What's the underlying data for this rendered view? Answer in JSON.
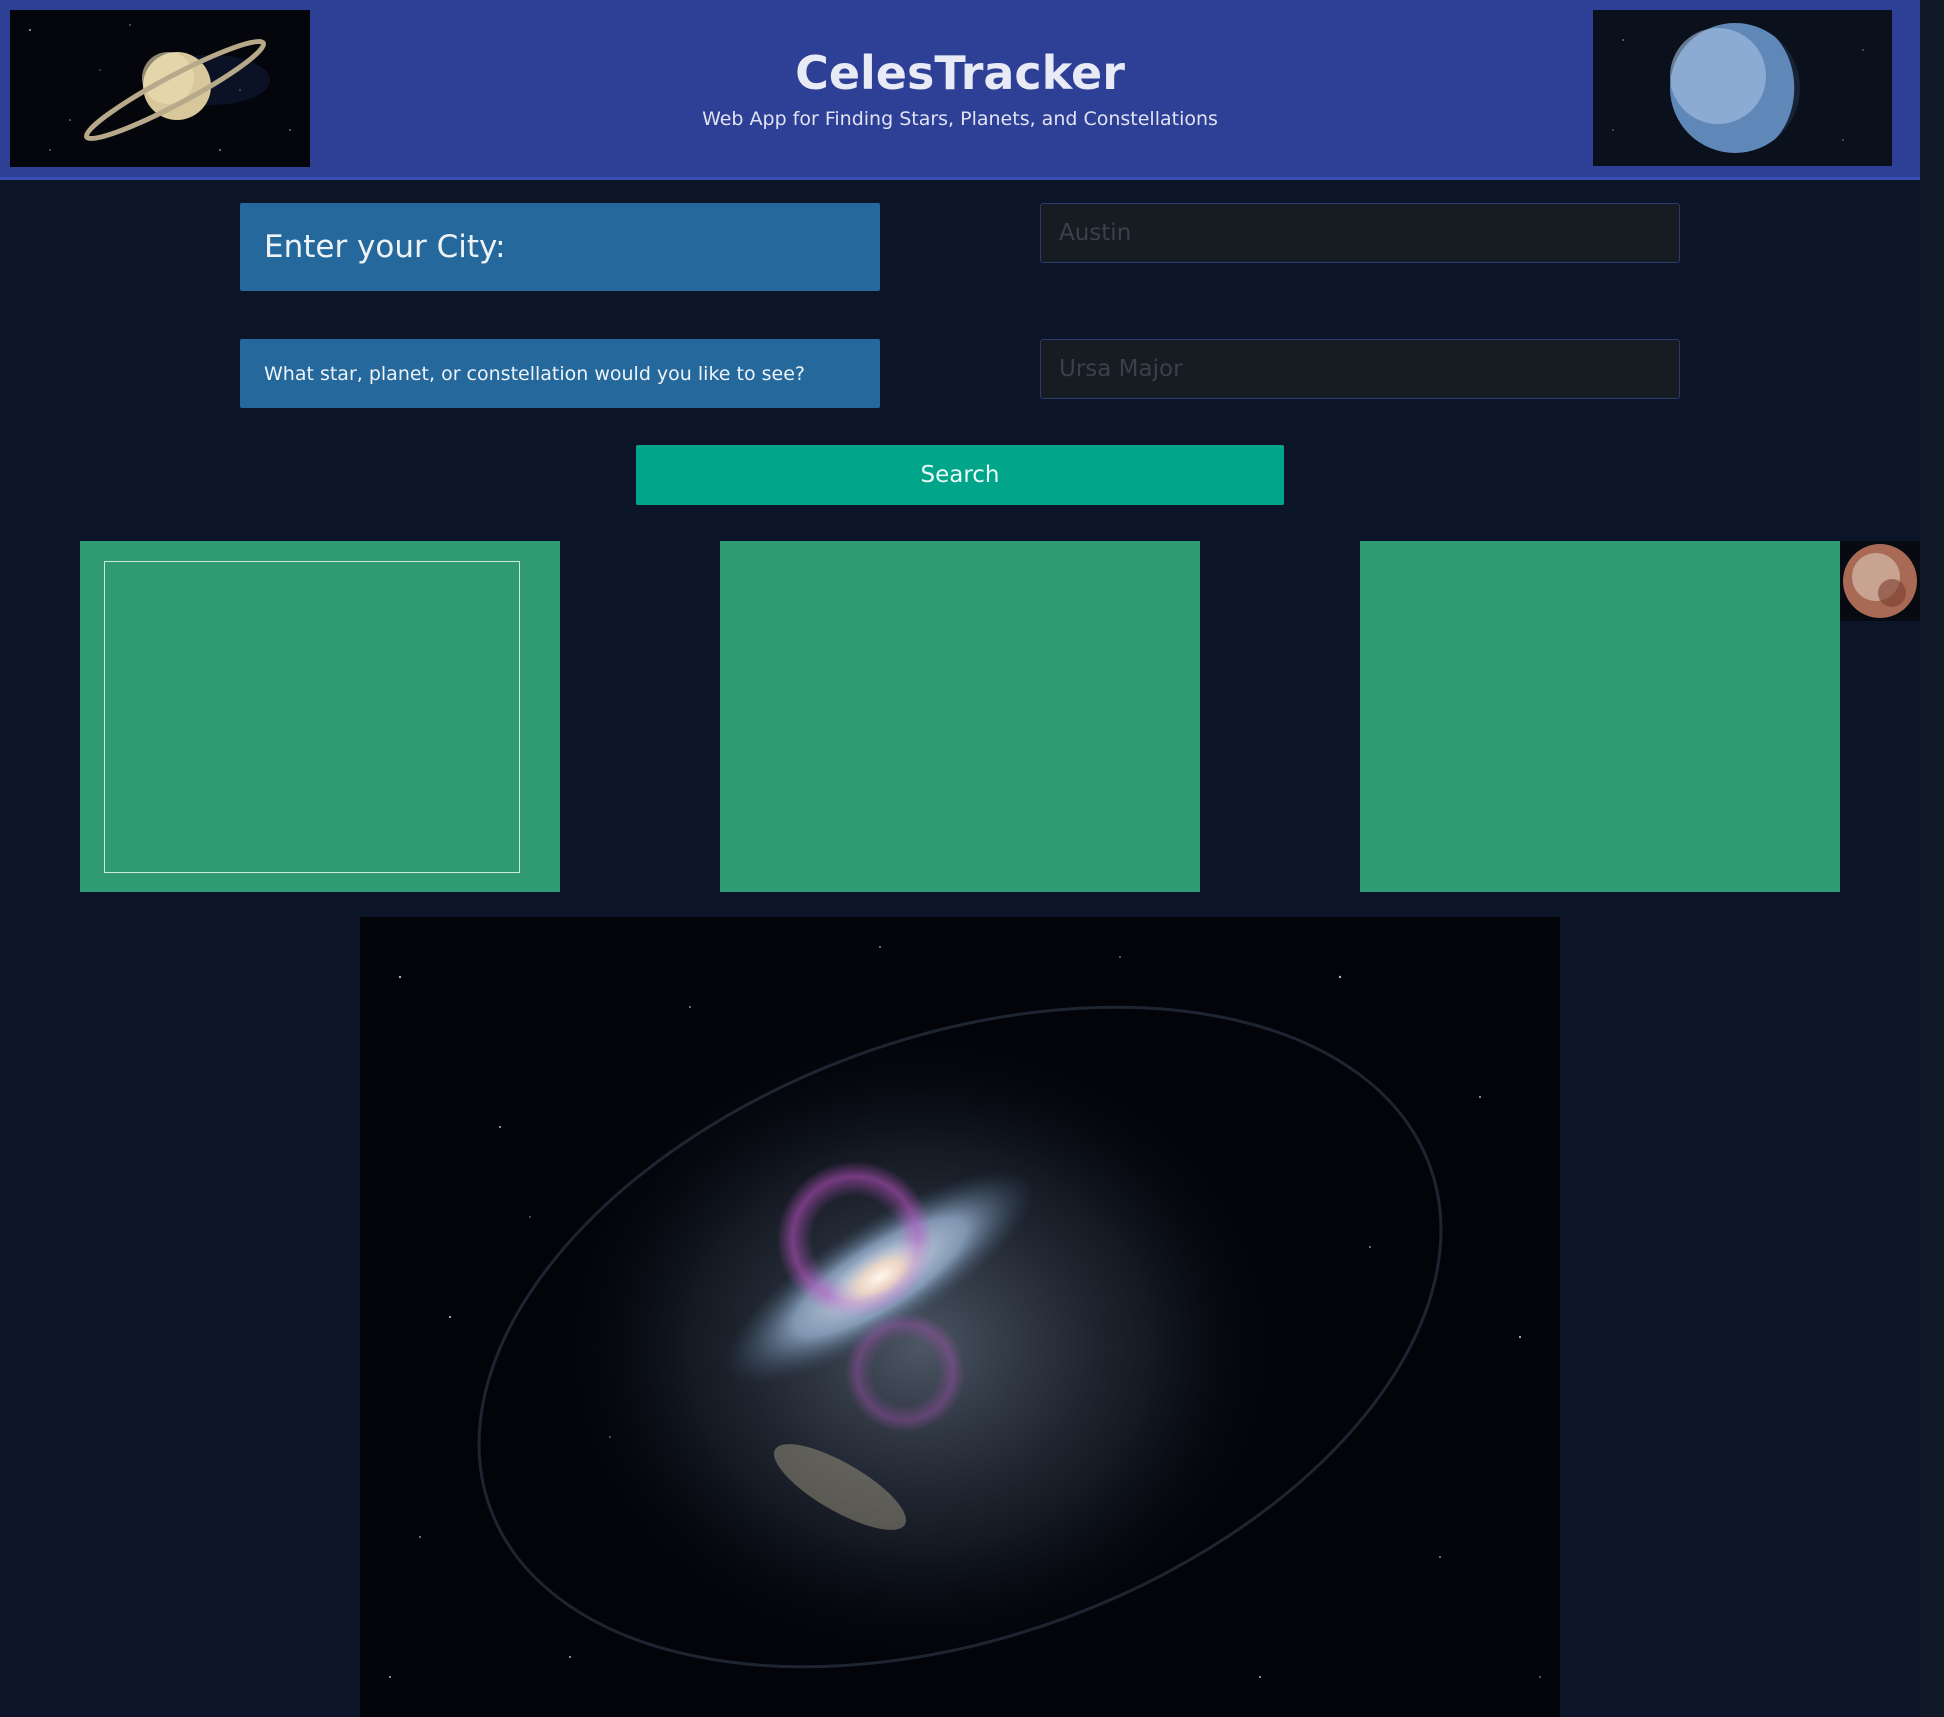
{
  "header": {
    "title": "CelesTracker",
    "subtitle": "Web App for Finding Stars, Planets, and Constellations",
    "left_image_icon": "saturn-image",
    "right_image_icon": "exoplanet-image"
  },
  "form": {
    "city_label": "Enter your City:",
    "city_placeholder": "Austin",
    "object_label": "What star, planet, or constellation would you like to see?",
    "object_placeholder": "Ursa Major",
    "search_label": "Search"
  },
  "results": {
    "cards": [
      "",
      "",
      ""
    ]
  },
  "images": {
    "thumb_icon": "planet-thumbnail",
    "hero_icon": "galaxy-image"
  },
  "colors": {
    "header_bg": "#2e3f96",
    "page_bg": "#0c1427",
    "label_bg": "#25689c",
    "search_bg": "#00a58a",
    "card_bg": "#2f9a73"
  }
}
